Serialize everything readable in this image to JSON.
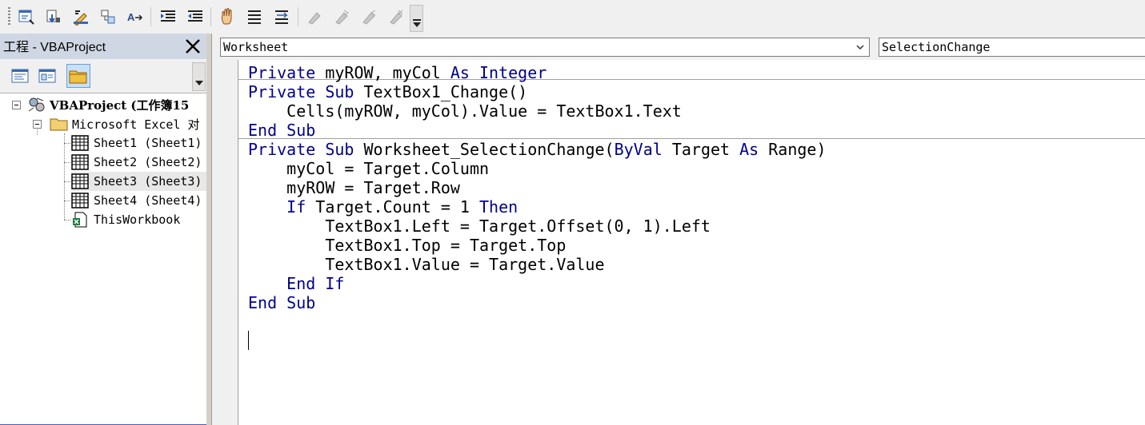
{
  "toolbar": {
    "buttons": [
      "insert-userform-icon",
      "step-into-icon",
      "design-mode-icon",
      "object-browser-icon",
      "quick-info-icon",
      "indent-icon",
      "outdent-icon",
      "toggle-breakpoint-icon",
      "comment-block-icon",
      "uncomment-block-icon",
      "bookmark-icon",
      "next-bookmark-icon",
      "prev-bookmark-icon",
      "clear-bookmarks-icon"
    ]
  },
  "project": {
    "title": "工程 - VBAProject",
    "tree": [
      {
        "label": "VBAProject (工作簿15",
        "bold": true
      },
      {
        "label": "Microsoft Excel 对"
      },
      {
        "label": "Sheet1 (Sheet1)"
      },
      {
        "label": "Sheet2 (Sheet2)"
      },
      {
        "label": "Sheet3 (Sheet3)"
      },
      {
        "label": "Sheet4 (Sheet4)"
      },
      {
        "label": "ThisWorkbook"
      }
    ]
  },
  "code": {
    "object_combo": "Worksheet",
    "proc_combo": "SelectionChange",
    "lines": [
      [
        [
          "kw",
          "Private "
        ],
        [
          "t",
          "myROW, myCol "
        ],
        [
          "kw",
          "As Integer"
        ]
      ],
      [
        [
          "kw",
          "Private Sub "
        ],
        [
          "t",
          "TextBox1_Change()"
        ]
      ],
      [
        [
          "t",
          "    Cells(myROW, myCol).Value = TextBox1.Text"
        ]
      ],
      [
        [
          "kw",
          "End Sub"
        ]
      ],
      [
        [
          "kw",
          "Private Sub "
        ],
        [
          "t",
          "Worksheet_SelectionChange("
        ],
        [
          "kw",
          "ByVal "
        ],
        [
          "t",
          "Target "
        ],
        [
          "kw",
          "As "
        ],
        [
          "t",
          "Range)"
        ]
      ],
      [
        [
          "t",
          "    myCol = Target.Column"
        ]
      ],
      [
        [
          "t",
          "    myROW = Target.Row"
        ]
      ],
      [
        [
          "kw",
          "    If "
        ],
        [
          "t",
          "Target.Count = 1 "
        ],
        [
          "kw",
          "Then"
        ]
      ],
      [
        [
          "t",
          "        TextBox1.Left = Target.Offset(0, 1).Left"
        ]
      ],
      [
        [
          "t",
          "        TextBox1.Top = Target.Top"
        ]
      ],
      [
        [
          "t",
          "        TextBox1.Value = Target.Value"
        ]
      ],
      [
        [
          "kw",
          "    End If"
        ]
      ],
      [
        [
          "kw",
          "End Sub"
        ]
      ]
    ]
  },
  "colors": {
    "keyword": "#00008b",
    "title_bar": "#cfd7e4"
  }
}
